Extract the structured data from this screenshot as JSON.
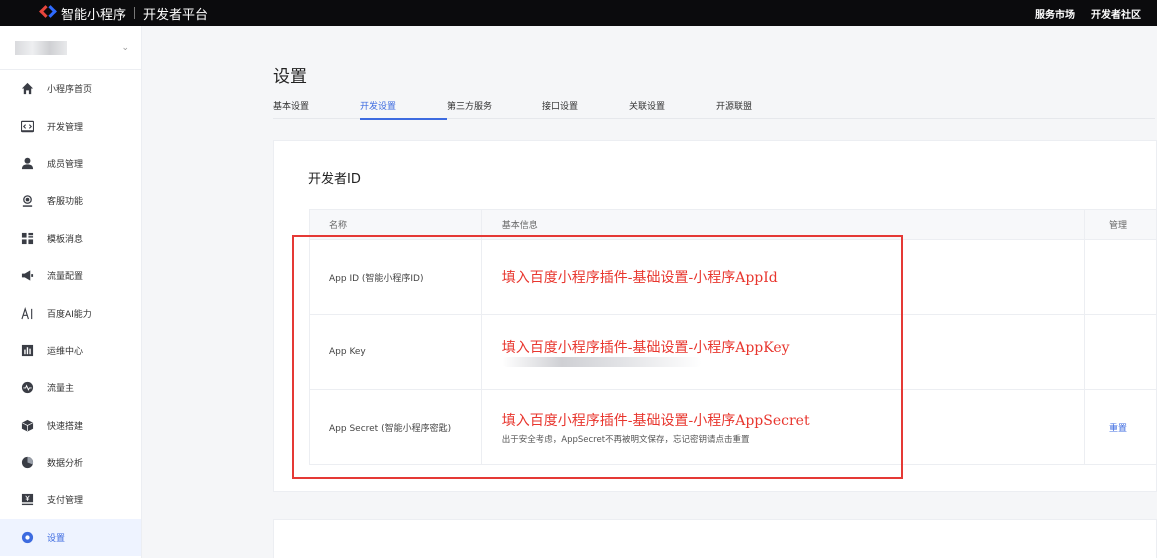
{
  "topbar": {
    "brand": "智能小程序",
    "subtitle": "开发者平台",
    "nav": [
      "服务市场",
      "开发者社区"
    ]
  },
  "sidebar": {
    "items": [
      {
        "label": "小程序首页",
        "icon": "home-icon"
      },
      {
        "label": "开发管理",
        "icon": "code-icon"
      },
      {
        "label": "成员管理",
        "icon": "user-icon"
      },
      {
        "label": "客服功能",
        "icon": "headset-icon"
      },
      {
        "label": "模板消息",
        "icon": "grid-icon"
      },
      {
        "label": "流量配置",
        "icon": "megaphone-icon"
      },
      {
        "label": "百度AI能力",
        "icon": "ai-icon"
      },
      {
        "label": "运维中心",
        "icon": "bar-chart-icon"
      },
      {
        "label": "流量主",
        "icon": "pulse-icon"
      },
      {
        "label": "快速搭建",
        "icon": "cube-icon"
      },
      {
        "label": "数据分析",
        "icon": "pie-icon"
      },
      {
        "label": "支付管理",
        "icon": "payment-icon"
      },
      {
        "label": "设置",
        "icon": "gear-icon",
        "active": true
      }
    ]
  },
  "main": {
    "title": "设置",
    "tabs": [
      "基本设置",
      "开发设置",
      "第三方服务",
      "接口设置",
      "关联设置",
      "开源联盟"
    ],
    "active_tab": "开发设置",
    "section_title": "开发者ID",
    "table": {
      "headers": [
        "名称",
        "基本信息",
        "管理"
      ],
      "rows": [
        {
          "name": "App ID (智能小程序ID)",
          "annotation": "填入百度小程序插件-基础设置-小程序AppId",
          "note": "",
          "action": ""
        },
        {
          "name": "App Key",
          "annotation": "填入百度小程序插件-基础设置-小程序AppKey",
          "note": "",
          "action": ""
        },
        {
          "name": "App Secret (智能小程序密匙)",
          "annotation": "填入百度小程序插件-基础设置-小程序AppSecret",
          "note": "出于安全考虑，AppSecret不再被明文保存，忘记密钥请点击重置",
          "action": "重置"
        }
      ]
    }
  },
  "colors": {
    "accent": "#3d6be0",
    "annotation": "#e8362e",
    "topbar": "#0b0b0d"
  }
}
